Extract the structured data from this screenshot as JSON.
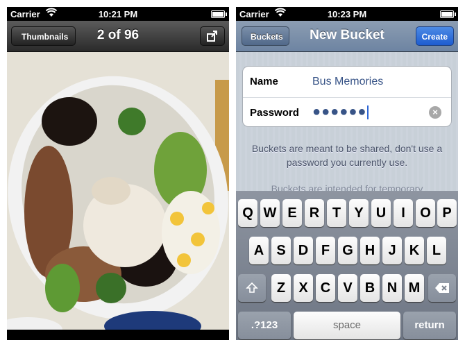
{
  "left_screen": {
    "status": {
      "carrier": "Carrier",
      "time": "10:21 PM"
    },
    "nav": {
      "back_label": "Thumbnails",
      "title": "2 of 96",
      "action_icon": "export-icon"
    },
    "photo": {
      "icon": "photo-icon"
    }
  },
  "right_screen": {
    "status": {
      "carrier": "Carrier",
      "time": "10:23 PM"
    },
    "nav": {
      "back_label": "Buckets",
      "title": "New Bucket",
      "create_label": "Create"
    },
    "form": {
      "name_label": "Name",
      "name_value": "Bus Memories",
      "password_label": "Password",
      "password_mask": "●●●●●●",
      "clear_icon": "clear-icon"
    },
    "hint1": "Buckets are meant to be shared, don't use a password you currently use.",
    "hint2": "Buckets are intended for temporary",
    "keyboard": {
      "row1": [
        "Q",
        "W",
        "E",
        "R",
        "T",
        "Y",
        "U",
        "I",
        "O",
        "P"
      ],
      "row2": [
        "A",
        "S",
        "D",
        "F",
        "G",
        "H",
        "J",
        "K",
        "L"
      ],
      "row3": [
        "Z",
        "X",
        "C",
        "V",
        "B",
        "N",
        "M"
      ],
      "shift_icon": "shift-icon",
      "delete_icon": "delete-icon",
      "numbers_label": ".?123",
      "space_label": "space",
      "return_label": "return"
    }
  },
  "colors": {
    "nav_dark": "#2a2a2a",
    "nav_blue": "#6d84a2",
    "create_blue": "#1d5cd0",
    "text_blue": "#385487"
  }
}
